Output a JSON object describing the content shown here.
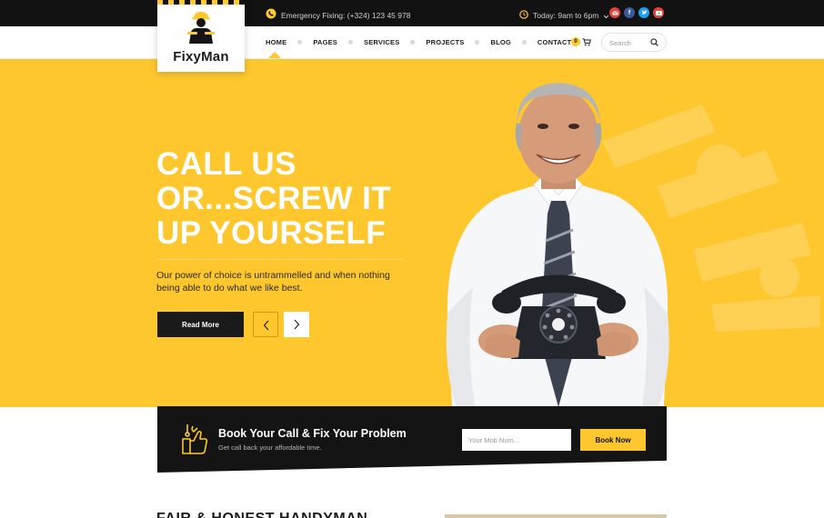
{
  "topbar": {
    "emergency_text": "Emergency Fixing: (+324) 123 45 978",
    "hours_text": "Today: 9am to 6pm",
    "social": [
      "email-icon",
      "facebook-icon",
      "twitter-icon",
      "youtube-icon"
    ]
  },
  "logo": {
    "name": "FixyMan"
  },
  "nav": {
    "items": [
      "HOME",
      "PAGES",
      "SERVICES",
      "PROJECTS",
      "BLOG",
      "CONTACT"
    ],
    "active": "HOME"
  },
  "cart": {
    "count": "0"
  },
  "search": {
    "placeholder": "Search"
  },
  "hero": {
    "title_lines": [
      "CALL US",
      "OR...SCREW IT",
      "UP YOURSELF"
    ],
    "description": "Our power of choice is untrammelled and when nothing being able to do what we like best.",
    "read_more": "Read More"
  },
  "booking": {
    "title": "Book Your Call & Fix Your Problem",
    "subtitle": "Get call back your affordable time.",
    "input_placeholder": "Your Mob Num...",
    "button": "Book Now"
  },
  "next_section": {
    "heading": "FAIR & HONEST HANDYMAN"
  },
  "colors": {
    "accent": "#fec72e",
    "dark": "#121212",
    "white": "#ffffff"
  }
}
